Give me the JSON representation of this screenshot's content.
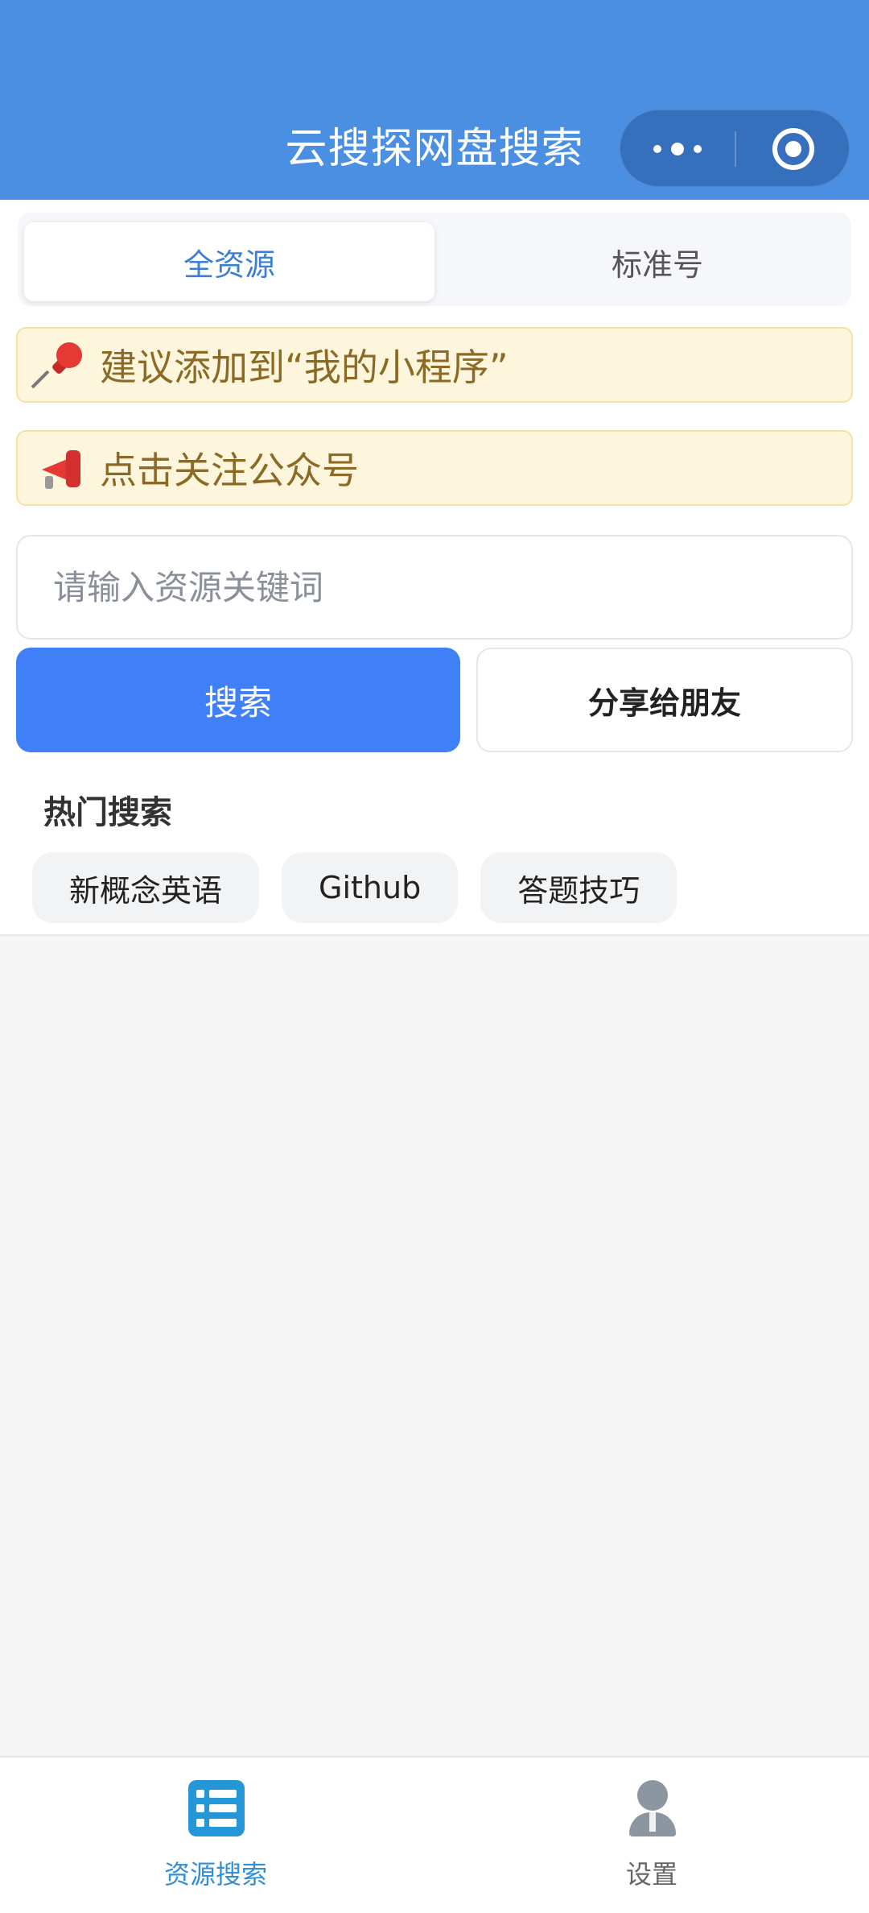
{
  "header": {
    "title": "云搜探网盘搜索",
    "capsule_more_icon": "more-dots-icon",
    "capsule_close_icon": "target-circle-icon",
    "background_color": "#4b8fe3"
  },
  "tabs": [
    {
      "label": "全资源",
      "active": true
    },
    {
      "label": "标准号",
      "active": false
    }
  ],
  "notices": [
    {
      "icon": "pushpin-icon",
      "text": "建议添加到“我的小程序”"
    },
    {
      "icon": "megaphone-icon",
      "text": "点击关注公众号"
    }
  ],
  "search": {
    "placeholder": "请输入资源关键词",
    "value": "",
    "search_button_label": "搜索",
    "share_button_label": "分享给朋友",
    "primary_color": "#3f7ff7"
  },
  "hot_search": {
    "title": "热门搜索",
    "tags": [
      "新概念英语",
      "Github",
      "答题技巧"
    ]
  },
  "tabbar": {
    "items": [
      {
        "label": "资源搜索",
        "icon": "list-icon",
        "active": true
      },
      {
        "label": "设置",
        "icon": "user-icon",
        "active": false
      }
    ],
    "active_color": "#2f8fd8"
  }
}
